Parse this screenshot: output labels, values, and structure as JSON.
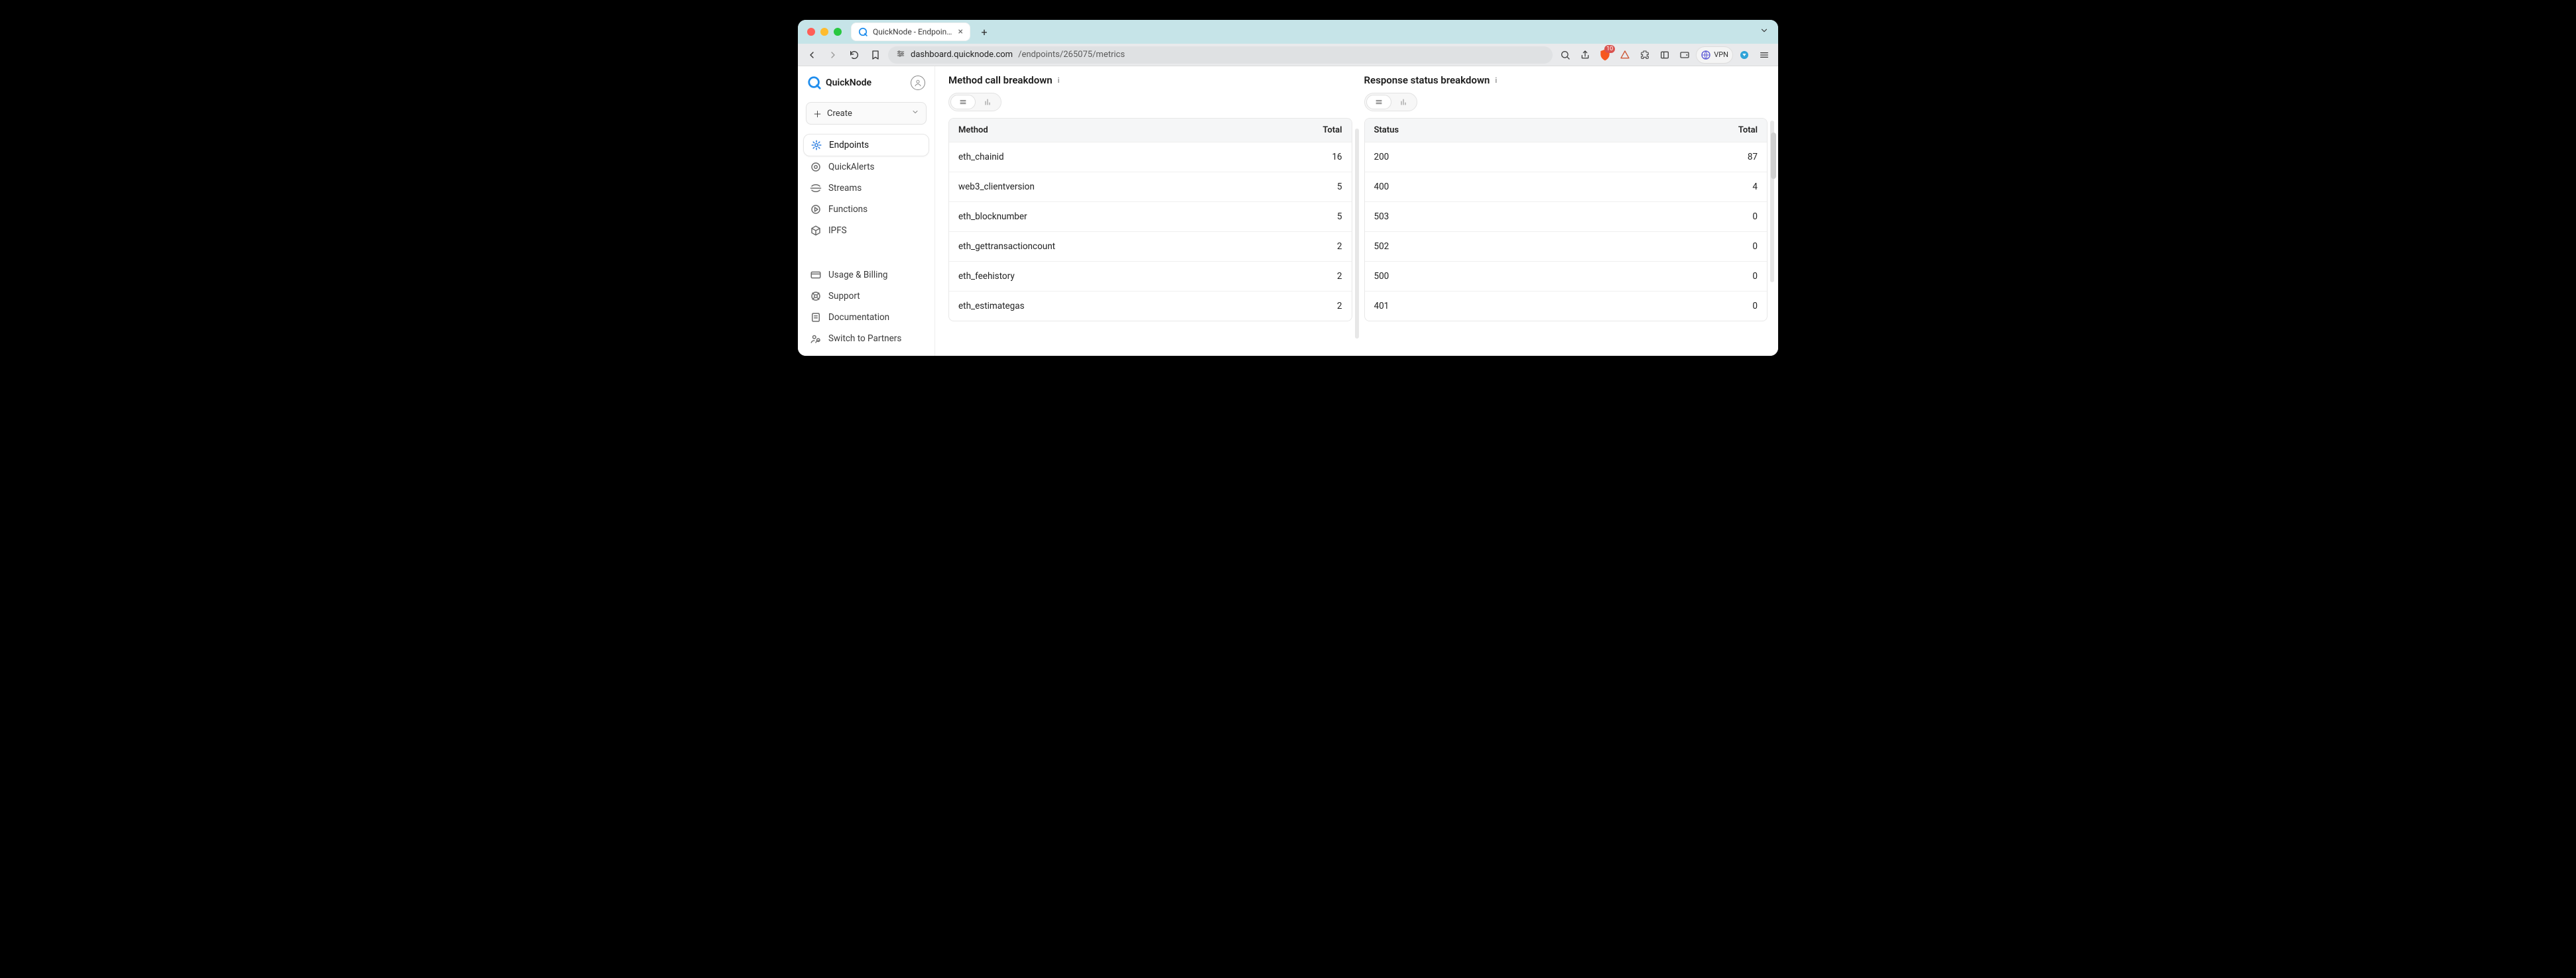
{
  "browser": {
    "tab_title": "QuickNode - Endpoint - Metri…",
    "url_host": "dashboard.quicknode.com",
    "url_path": "/endpoints/265075/metrics",
    "shield_count": "10",
    "vpn_label": "VPN"
  },
  "sidebar": {
    "brand": "QuickNode",
    "create_label": "Create",
    "nav": [
      {
        "label": "Endpoints"
      },
      {
        "label": "QuickAlerts"
      },
      {
        "label": "Streams"
      },
      {
        "label": "Functions"
      },
      {
        "label": "IPFS"
      }
    ],
    "footer": [
      {
        "label": "Usage & Billing"
      },
      {
        "label": "Support"
      },
      {
        "label": "Documentation"
      },
      {
        "label": "Switch to Partners"
      }
    ]
  },
  "panes": {
    "methods": {
      "title": "Method call breakdown",
      "columns": {
        "c1": "Method",
        "c2": "Total"
      },
      "rows": [
        {
          "c1": "eth_chainid",
          "c2": "16"
        },
        {
          "c1": "web3_clientversion",
          "c2": "5"
        },
        {
          "c1": "eth_blocknumber",
          "c2": "5"
        },
        {
          "c1": "eth_gettransactioncount",
          "c2": "2"
        },
        {
          "c1": "eth_feehistory",
          "c2": "2"
        },
        {
          "c1": "eth_estimategas",
          "c2": "2"
        }
      ]
    },
    "status": {
      "title": "Response status breakdown",
      "columns": {
        "c1": "Status",
        "c2": "Total"
      },
      "rows": [
        {
          "c1": "200",
          "c2": "87"
        },
        {
          "c1": "400",
          "c2": "4"
        },
        {
          "c1": "503",
          "c2": "0"
        },
        {
          "c1": "502",
          "c2": "0"
        },
        {
          "c1": "500",
          "c2": "0"
        },
        {
          "c1": "401",
          "c2": "0"
        }
      ]
    }
  },
  "chart_data": [
    {
      "type": "table",
      "title": "Method call breakdown",
      "columns": [
        "Method",
        "Total"
      ],
      "rows": [
        [
          "eth_chainid",
          16
        ],
        [
          "web3_clientversion",
          5
        ],
        [
          "eth_blocknumber",
          5
        ],
        [
          "eth_gettransactioncount",
          2
        ],
        [
          "eth_feehistory",
          2
        ],
        [
          "eth_estimategas",
          2
        ]
      ]
    },
    {
      "type": "table",
      "title": "Response status breakdown",
      "columns": [
        "Status",
        "Total"
      ],
      "rows": [
        [
          "200",
          87
        ],
        [
          "400",
          4
        ],
        [
          "503",
          0
        ],
        [
          "502",
          0
        ],
        [
          "500",
          0
        ],
        [
          "401",
          0
        ]
      ]
    }
  ]
}
